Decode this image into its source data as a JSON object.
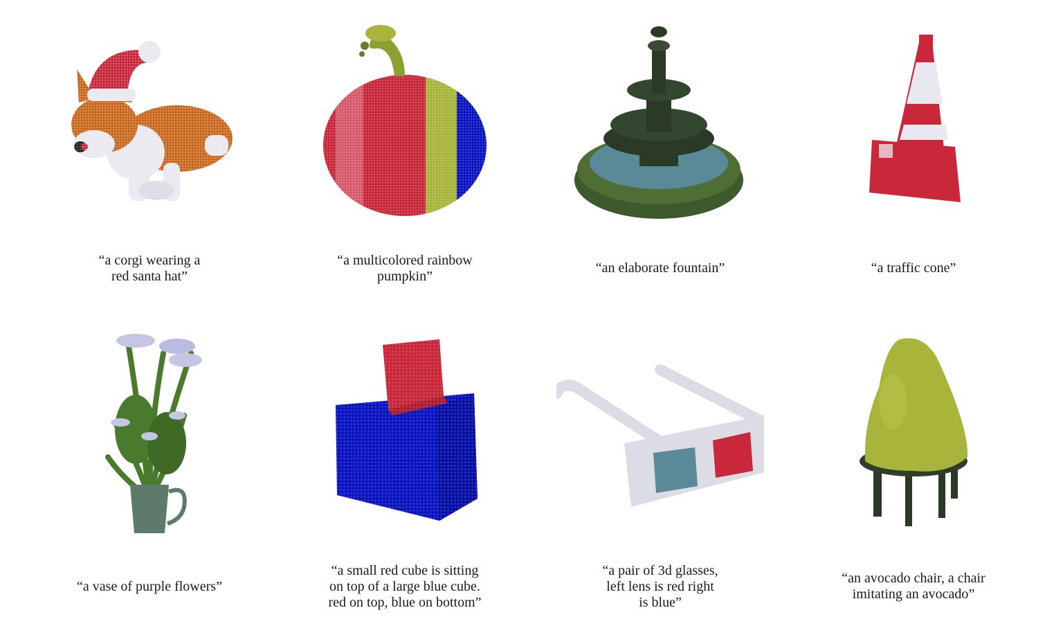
{
  "figures": [
    {
      "name": "corgi",
      "caption": [
        "“a corgi wearing a",
        "red santa hat”"
      ]
    },
    {
      "name": "pumpkin",
      "caption": [
        "“a multicolored rainbow",
        "pumpkin”"
      ]
    },
    {
      "name": "fountain",
      "caption": [
        "“an elaborate fountain”"
      ]
    },
    {
      "name": "traffic-cone",
      "caption": [
        "“a traffic cone”"
      ]
    },
    {
      "name": "flower-vase",
      "caption": [
        "“a vase of purple flowers”"
      ]
    },
    {
      "name": "cubes",
      "caption": [
        "“a small red cube is sitting",
        "on top of a large blue cube.",
        "red on top, blue on bottom”"
      ]
    },
    {
      "name": "glasses",
      "caption": [
        "“a pair of 3d glasses,",
        "left lens is red right",
        "is blue”"
      ]
    },
    {
      "name": "avocado-chair",
      "caption": [
        "“an avocado chair, a chair",
        "imitating an avocado”"
      ]
    }
  ],
  "colors": {
    "red": "#c8283a",
    "blue": "#0a14c0",
    "green": "#4a7a2c",
    "olive": "#a8b43a",
    "white": "#e8e8ee",
    "orange": "#c9681e",
    "dark": "#2a3a26",
    "teal": "#5a8a98"
  }
}
